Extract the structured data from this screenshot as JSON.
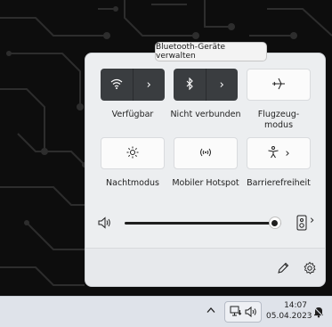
{
  "tooltip": {
    "text": "Bluetooth-Geräte verwalten"
  },
  "quick_settings": {
    "tiles": [
      {
        "id": "wifi",
        "label": "Verfügbar",
        "state": "on",
        "icon": "wifi-icon",
        "has_chevron": true
      },
      {
        "id": "bluetooth",
        "label": "Nicht verbunden",
        "state": "on",
        "icon": "bluetooth-icon",
        "has_chevron": true
      },
      {
        "id": "airplane",
        "label": "Flugzeug-\nmodus",
        "state": "off",
        "icon": "airplane-icon",
        "has_chevron": false
      },
      {
        "id": "night",
        "label": "Nachtmodus",
        "state": "off",
        "icon": "brightness-icon",
        "has_chevron": false
      },
      {
        "id": "hotspot",
        "label": "Mobiler Hotspot",
        "state": "off",
        "icon": "hotspot-icon",
        "has_chevron": false
      },
      {
        "id": "accessibility",
        "label": "Barrierefreiheit",
        "state": "off",
        "icon": "accessibility-icon",
        "has_chevron": true
      }
    ],
    "glyphs": {
      "chevron": "›",
      "wifi": "ᯤ",
      "bluetooth": "✱",
      "airplane": "✈",
      "night": "☀",
      "hotspot": "((·))",
      "accessibility": "♿"
    },
    "volume": {
      "level_percent": 96,
      "icon": "speaker-icon",
      "device_icon": "audio-device-icon"
    },
    "footer": {
      "edit_icon": "pencil-icon",
      "settings_icon": "gear-icon"
    }
  },
  "taskbar": {
    "overflow_icon": "chevron-up-icon",
    "network_icon": "network-icon",
    "volume_icon": "speaker-icon",
    "time": "14:07",
    "date": "05.04.2023",
    "notification_icon": "notification-icon"
  },
  "colors": {
    "tile_on": "#3a3d40",
    "tile_off": "#fbfbfb",
    "panel_bg": "#eceef0",
    "taskbar_bg": "#dfe3ea",
    "wallpaper_bg": "#0d0d0d"
  }
}
